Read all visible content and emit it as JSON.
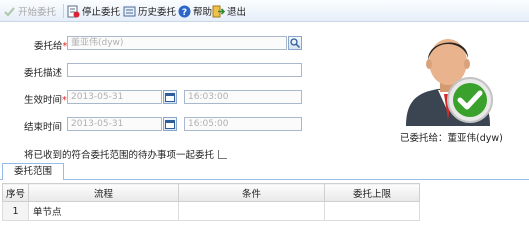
{
  "toolbar": {
    "start_label": "开始委托",
    "stop_label": "停止委托",
    "history_label": "历史委托",
    "help_label": "帮助",
    "exit_label": "退出"
  },
  "form": {
    "delegate_to_label": "委托给",
    "delegate_to_value": "董亚伟(dyw)",
    "description_label": "委托描述",
    "description_value": "",
    "start_time_label": "生效时间",
    "start_date": "2013-05-31",
    "start_clock": "16:03:00",
    "end_time_label": "结束时间",
    "end_date": "2013-05-31",
    "end_clock": "16:05:00",
    "include_pending_label": "将已收到的符合委托范围的待办事项一起委托"
  },
  "profile": {
    "caption": "已委托给：董亚伟(dyw)"
  },
  "scope_tab": {
    "label": "委托范围"
  },
  "grid": {
    "columns": [
      "序号",
      "流程",
      "条件",
      "委托上限"
    ],
    "rows": [
      {
        "index": "1",
        "process": "单节点",
        "condition": "",
        "limit": ""
      }
    ]
  },
  "colors": {
    "toolbar_top": "#fbfdff",
    "toolbar_bottom": "#e6eef8",
    "required_star": "#e02020",
    "check_green": "#3aa12c",
    "tab_border": "#99bbe8"
  }
}
